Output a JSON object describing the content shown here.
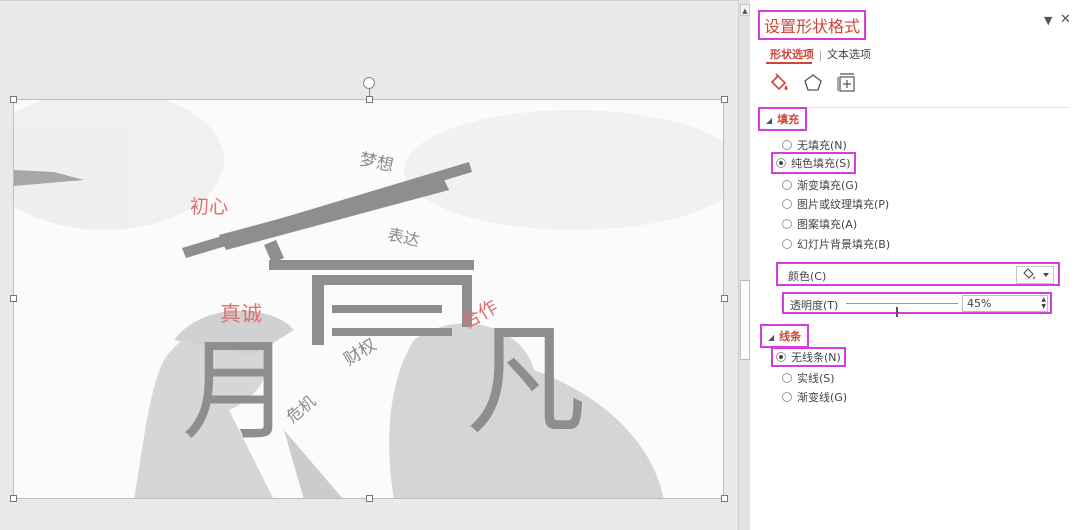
{
  "pane": {
    "title": "设置形状格式",
    "tabs": [
      {
        "label": "形状选项",
        "active": true
      },
      {
        "label": "文本选项",
        "active": false
      }
    ],
    "icons": [
      "fill-line-icon",
      "effects-pentagon-icon",
      "size-properties-icon"
    ],
    "fill_section": {
      "title": "填充",
      "options": [
        {
          "label": "无填充(N)",
          "selected": false
        },
        {
          "label": "纯色填充(S)",
          "selected": true
        },
        {
          "label": "渐变填充(G)",
          "selected": false
        },
        {
          "label": "图片或纹理填充(P)",
          "selected": false
        },
        {
          "label": "图案填充(A)",
          "selected": false
        },
        {
          "label": "幻灯片背景填充(B)",
          "selected": false
        }
      ],
      "color_label": "颜色(C)",
      "transparency_label": "透明度(T)",
      "transparency_value": "45%",
      "transparency_percent": 45
    },
    "line_section": {
      "title": "线条",
      "options": [
        {
          "label": "无线条(N)",
          "selected": true
        },
        {
          "label": "实线(S)",
          "selected": false
        },
        {
          "label": "渐变线(G)",
          "selected": false
        }
      ]
    }
  },
  "slide": {
    "words": {
      "dream": "梦想",
      "origin": "初心",
      "express": "表达",
      "sincere": "真诚",
      "cooperate": "合作",
      "wealth": "财权",
      "crisis": "危机"
    },
    "big_char": "月",
    "big_char_2": "凡"
  },
  "colors": {
    "accent": "#d0453a",
    "highlight": "#d63be0",
    "word_red": "#e07070",
    "word_gray": "#8a8a8a",
    "glyph_gray": "#8e8e8e"
  }
}
